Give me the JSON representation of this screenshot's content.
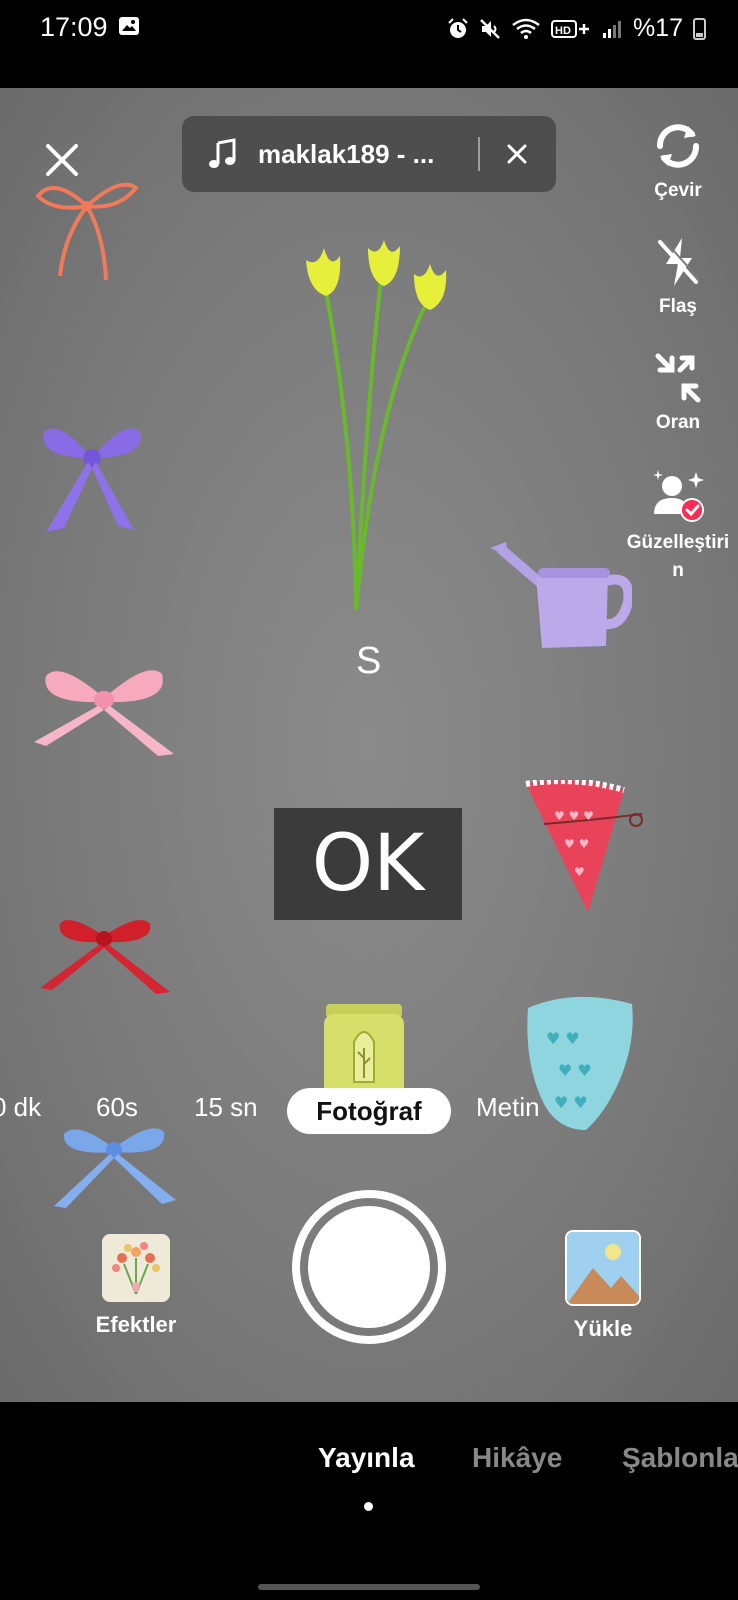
{
  "status_bar": {
    "time": "17:09",
    "battery_text": "%17",
    "icons": [
      "gallery-icon",
      "alarm-icon",
      "mute-icon",
      "wifi-icon",
      "hd-plus-icon",
      "signal-icon",
      "battery-icon"
    ]
  },
  "top": {
    "music_title": "maklak189 - ...",
    "close_icon": "close-icon"
  },
  "side_tools": [
    {
      "label": "Çevir",
      "icon": "flip-camera-icon"
    },
    {
      "label": "Flaş",
      "icon": "flash-off-icon"
    },
    {
      "label": "Oran",
      "icon": "ratio-icon"
    },
    {
      "label": "Güzelleştiri",
      "label2": "n",
      "icon": "beautify-icon"
    }
  ],
  "overlay": {
    "letter": "S",
    "ok_text": "OK"
  },
  "modes": {
    "items": [
      "0 dk",
      "60s",
      "15 sn",
      "Fotoğraf",
      "Metin"
    ],
    "active": "Fotoğraf"
  },
  "bottom_controls": {
    "effects_label": "Efektler",
    "upload_label": "Yükle"
  },
  "bottom_tabs": {
    "items": [
      "Yayınla",
      "Hikâye",
      "Şablonla"
    ],
    "active": "Yayınla"
  },
  "colors": {
    "background": "#7a7a7a",
    "accent_badge": "#fe2c55"
  }
}
